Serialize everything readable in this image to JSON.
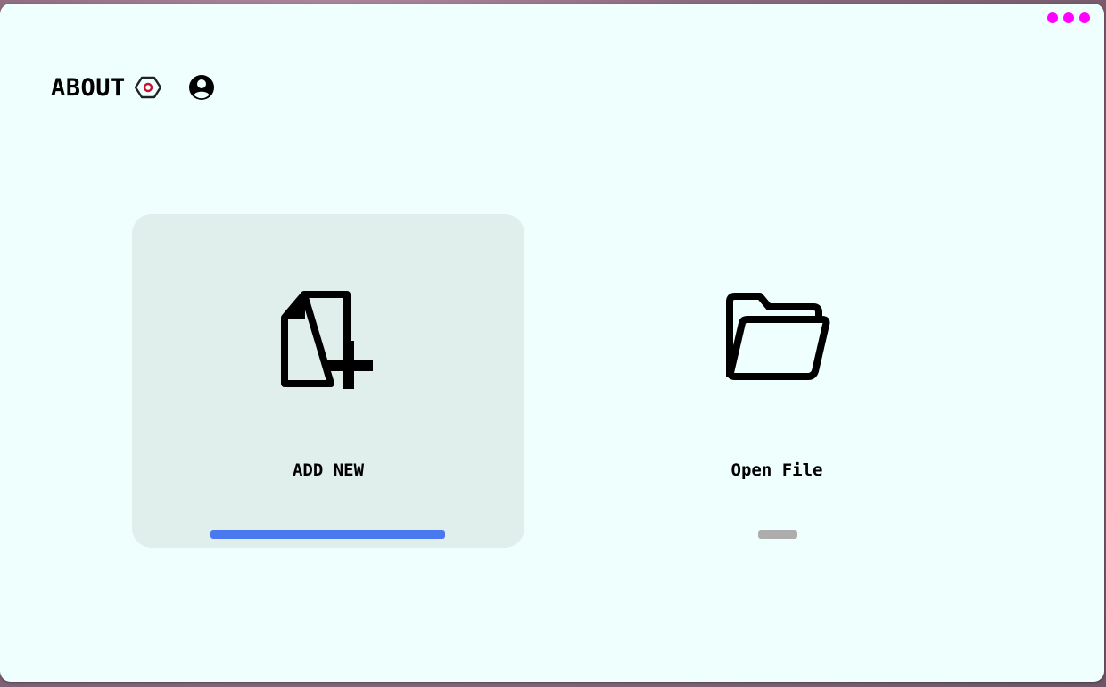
{
  "header": {
    "title": "ABOUT",
    "settings_icon": "settings-hex-icon",
    "user_icon": "user-circle-icon"
  },
  "window_menu": {
    "icon": "more-dots-icon",
    "color": "#ff00ff"
  },
  "cards": [
    {
      "label": "ADD NEW",
      "icon": "file-add-icon",
      "selected": true,
      "indicator_color": "#4a78ee"
    },
    {
      "label": "Open File",
      "icon": "folder-open-icon",
      "selected": false,
      "indicator_color": "#adadad"
    }
  ],
  "colors": {
    "window_background": "#effffe",
    "selected_card_background": "#e0eeec",
    "settings_accent": "#c8102e"
  }
}
